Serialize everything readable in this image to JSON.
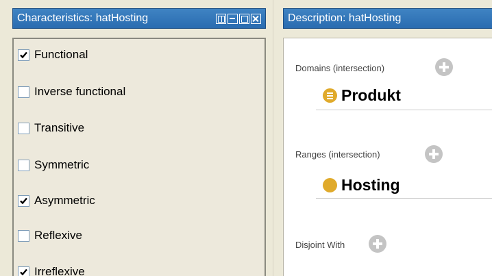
{
  "characteristics_panel": {
    "title": "Characteristics: hatHosting",
    "items": [
      {
        "label": "Functional",
        "checked": true
      },
      {
        "label": "Inverse functional",
        "checked": false
      },
      {
        "label": "Transitive",
        "checked": false
      },
      {
        "label": "Symmetric",
        "checked": false
      },
      {
        "label": "Asymmetric",
        "checked": true
      },
      {
        "label": "Reflexive",
        "checked": false
      },
      {
        "label": "Irreflexive",
        "checked": true
      }
    ]
  },
  "description_panel": {
    "title": "Description: hatHosting",
    "domains": {
      "label": "Domains (intersection)",
      "value": "Produkt",
      "icon": "defined-class-icon"
    },
    "ranges": {
      "label": "Ranges (intersection)",
      "value": "Hosting",
      "icon": "class-icon"
    },
    "disjoint": {
      "label": "Disjoint With"
    }
  },
  "colors": {
    "header_blue": "#2a6cb0",
    "class_orange": "#e0aa2b",
    "add_button_gray": "#c4c4c4"
  }
}
